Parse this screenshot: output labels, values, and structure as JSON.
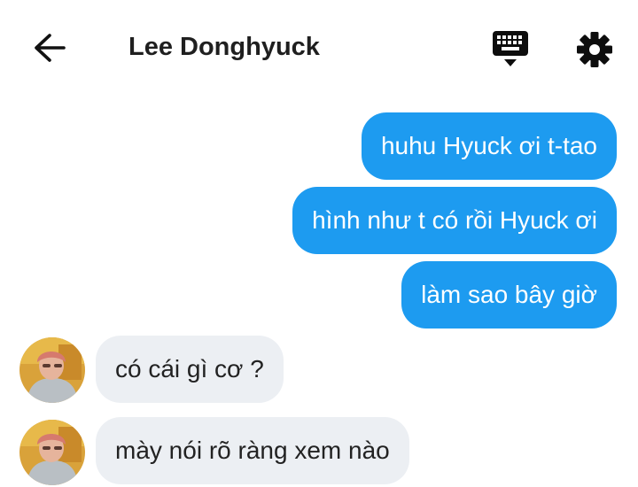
{
  "header": {
    "back_icon": "arrow-left-icon",
    "title": "Lee Donghyuck",
    "keyboard_icon": "keyboard-icon",
    "settings_icon": "gear-icon"
  },
  "colors": {
    "sent_bubble": "#1d9bf0",
    "received_bubble": "#eceff3",
    "text_dark": "#1f1f1f"
  },
  "messages": [
    {
      "side": "sent",
      "text": "huhu Hyuck ơi t-tao"
    },
    {
      "side": "sent",
      "text": "hình như t có rồi Hyuck ơi"
    },
    {
      "side": "sent",
      "text": "làm sao bây giờ"
    },
    {
      "side": "received",
      "text": "có cái gì cơ ?"
    },
    {
      "side": "received",
      "text": "mày nói rõ ràng xem nào"
    }
  ]
}
